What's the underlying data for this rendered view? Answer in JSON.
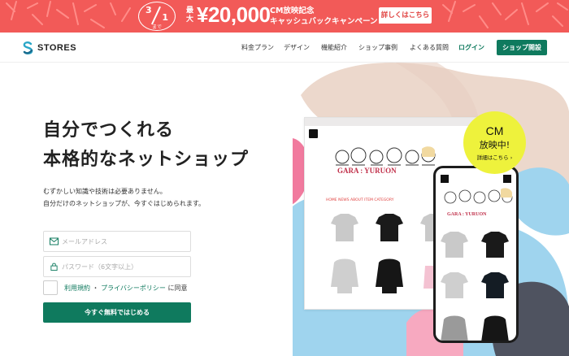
{
  "promo": {
    "date_month": "3",
    "date_day": "1",
    "date_until": "まで",
    "max_label": "最大",
    "amount": "¥20,000",
    "headline_1": "CM放映記念",
    "headline_2": "キャッシュバックキャンペーン！",
    "cta": "詳しくはこちら"
  },
  "header": {
    "logo": "STORES",
    "nav": [
      "料金プラン",
      "デザイン",
      "機能紹介",
      "ショップ事例",
      "よくある質問"
    ],
    "login": "ログイン",
    "open_shop": "ショップ開設"
  },
  "hero": {
    "title_1": "自分でつくれる",
    "title_2": "本格的なネットショップ",
    "desc_1": "むずかしい知識や技術は必要ありません。",
    "desc_2": "自分だけのネットショップが、今すぐはじめられます。",
    "email_placeholder": "メールアドレス",
    "password_placeholder": "パスワード（6文字以上）",
    "terms": "利用規約",
    "separator": "・",
    "privacy": "プライバシーポリシー",
    "agree": "に同意",
    "submit": "今すぐ無料ではじめる"
  },
  "preview": {
    "shop_nav": "HOME  NEWS  ABOUT  ITEM  CATEGORY",
    "art_title": "GARA : YURUON"
  },
  "cm_badge": {
    "line1": "CM",
    "line2": "放映中!",
    "line3": "詳細はこちら ›"
  },
  "colors": {
    "promo_red": "#f25a58",
    "brand_green": "#0f7a5e",
    "badge_yellow": "#eef23c"
  }
}
